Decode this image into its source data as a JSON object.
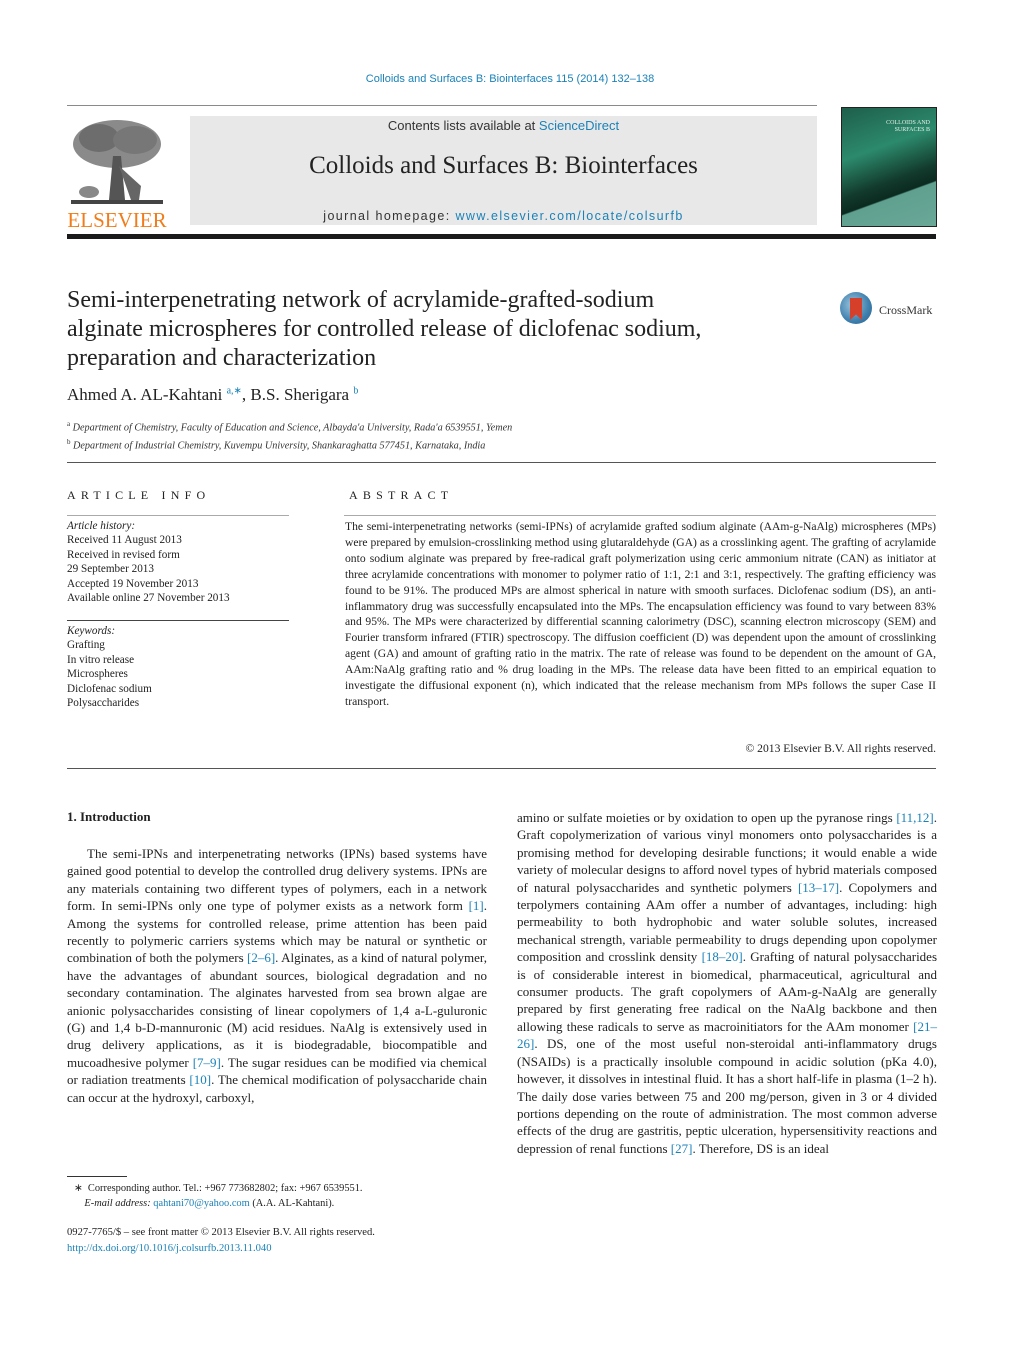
{
  "running_head": "Colloids and Surfaces B: Biointerfaces 115 (2014) 132–138",
  "header": {
    "publisher_logo": "ELSEVIER",
    "contents_prefix": "Contents lists available at ",
    "contents_link": "ScienceDirect",
    "journal_title": "Colloids and Surfaces B: Biointerfaces",
    "homepage_prefix": "journal homepage: ",
    "homepage_link": "www.elsevier.com/locate/colsurfb",
    "cover_text_1": "COLLOIDS AND",
    "cover_text_2": "SURFACES B"
  },
  "article": {
    "title_line_1": "Semi-interpenetrating network of acrylamide-grafted-sodium",
    "title_line_2": "alginate microspheres for controlled release of diclofenac sodium,",
    "title_line_3": "preparation and characterization",
    "crossmark_label": "CrossMark",
    "authors": [
      {
        "name": "Ahmed A. AL-Kahtani",
        "marks": "a,∗"
      },
      {
        "name": "B.S. Sherigara",
        "marks": "b"
      }
    ],
    "author_separator": ", ",
    "affiliations": [
      {
        "mark": "a",
        "text": "Department of Chemistry, Faculty of Education and Science, Albayda'a University, Rada'a 6539551, Yemen"
      },
      {
        "mark": "b",
        "text": "Department of Industrial Chemistry, Kuvempu University, Shankaraghatta 577451, Karnataka, India"
      }
    ]
  },
  "article_info": {
    "heading": "ARTICLE INFO",
    "history_label": "Article history:",
    "history": [
      "Received 11 August 2013",
      "Received in revised form",
      "29 September 2013",
      "Accepted 19 November 2013",
      "Available online 27 November 2013"
    ],
    "keywords_label": "Keywords:",
    "keywords": [
      "Grafting",
      "In vitro release",
      "Microspheres",
      "Diclofenac sodium",
      "Polysaccharides"
    ]
  },
  "abstract": {
    "heading": "ABSTRACT",
    "text": "The semi-interpenetrating networks (semi-IPNs) of acrylamide grafted sodium alginate (AAm-g-NaAlg) microspheres (MPs) were prepared by emulsion-crosslinking method using glutaraldehyde (GA) as a crosslinking agent. The grafting of acrylamide onto sodium alginate was prepared by free-radical graft polymerization using ceric ammonium nitrate (CAN) as initiator at three acrylamide concentrations with monomer to polymer ratio of 1:1, 2:1 and 3:1, respectively. The grafting efficiency was found to be 91%. The produced MPs are almost spherical in nature with smooth surfaces. Diclofenac sodium (DS), an anti-inflammatory drug was successfully encapsulated into the MPs. The encapsulation efficiency was found to vary between 83% and 95%. The MPs were characterized by differential scanning calorimetry (DSC), scanning electron microscopy (SEM) and Fourier transform infrared (FTIR) spectroscopy. The diffusion coefficient (D) was dependent upon the amount of crosslinking agent (GA) and amount of grafting ratio in the matrix. The rate of release was found to be dependent on the amount of GA, AAm:NaAlg grafting ratio and % drug loading in the MPs. The release data have been fitted to an empirical equation to investigate the diffusional exponent (n), which indicated that the release mechanism from MPs follows the super Case II transport.",
    "copyright": "© 2013 Elsevier B.V. All rights reserved."
  },
  "introduction": {
    "heading": "1.  Introduction",
    "left_segments": [
      {
        "t": "The semi-IPNs and interpenetrating networks (IPNs) based systems have gained good potential to develop the controlled drug delivery systems. IPNs are any materials containing two different types of polymers, each in a network form. In semi-IPNs only one type of polymer exists as a network form "
      },
      {
        "ref": "[1]"
      },
      {
        "t": ". Among the systems for controlled release, prime attention has been paid recently to polymeric carriers systems which may be natural or synthetic or combination of both the polymers "
      },
      {
        "ref": "[2–6]"
      },
      {
        "t": ". Alginates, as a kind of natural polymer, have the advantages of abundant sources, biological degradation and no secondary contamination. The alginates harvested from sea brown algae are anionic polysaccharides consisting of linear copolymers of 1,4 a-L-guluronic (G) and 1,4 b-D-mannuronic (M) acid residues. NaAlg is extensively used in drug delivery applications, as it is biodegradable, biocompatible and mucoadhesive polymer "
      },
      {
        "ref": "[7–9]"
      },
      {
        "t": ". The sugar residues can be modified via chemical or radiation treatments "
      },
      {
        "ref": "[10]"
      },
      {
        "t": ". The chemical modification of polysaccharide chain can occur at the hydroxyl, carboxyl,"
      }
    ],
    "right_segments": [
      {
        "t": "amino or sulfate moieties or by oxidation to open up the pyranose rings "
      },
      {
        "ref": "[11,12]"
      },
      {
        "t": ". Graft copolymerization of various vinyl monomers onto polysaccharides is a promising method for developing desirable functions; it would enable a wide variety of molecular designs to afford novel types of hybrid materials composed of natural polysaccharides and synthetic polymers "
      },
      {
        "ref": "[13–17]"
      },
      {
        "t": ". Copolymers and terpolymers containing AAm offer a number of advantages, including: high permeability to both hydrophobic and water soluble solutes, increased mechanical strength, variable permeability to drugs depending upon copolymer composition and crosslink density "
      },
      {
        "ref": "[18–20]"
      },
      {
        "t": ". Grafting of natural polysaccharides is of considerable interest in biomedical, pharmaceutical, agricultural and consumer products. The graft copolymers of AAm-g-NaAlg are generally prepared by first generating free radical on the NaAlg backbone and then allowing these radicals to serve as macroinitiators for the AAm monomer "
      },
      {
        "ref": "[21–26]"
      },
      {
        "t": ". DS, one of the most useful non-steroidal anti-inflammatory drugs (NSAIDs) is a practically insoluble compound in acidic solution (pKa 4.0), however, it dissolves in intestinal fluid. It has a short half-life in plasma (1–2 h). The daily dose varies between 75 and 200 mg/person, given in 3 or 4 divided portions depending on the route of administration. The most common adverse effects of the drug are gastritis, peptic ulceration, hypersensitivity reactions and depression of renal functions "
      },
      {
        "ref": "[27]"
      },
      {
        "t": ". Therefore, DS is an ideal"
      }
    ]
  },
  "footnote": {
    "mark": "∗",
    "corresponding": "Corresponding author. Tel.: +967 773682802; fax: +967 6539551.",
    "email_label": "E-mail address: ",
    "email": "qahtani70@yahoo.com",
    "email_suffix": " (A.A. AL-Kahtani)."
  },
  "front_matter": {
    "issn_line": "0927-7765/$ – see front matter © 2013 Elsevier B.V. All rights reserved.",
    "doi": "http://dx.doi.org/10.1016/j.colsurfb.2013.11.040"
  },
  "colors": {
    "link": "#1b82b8",
    "elsevier_orange": "#f07d1a",
    "masthead_gray": "#e8e8e8"
  }
}
